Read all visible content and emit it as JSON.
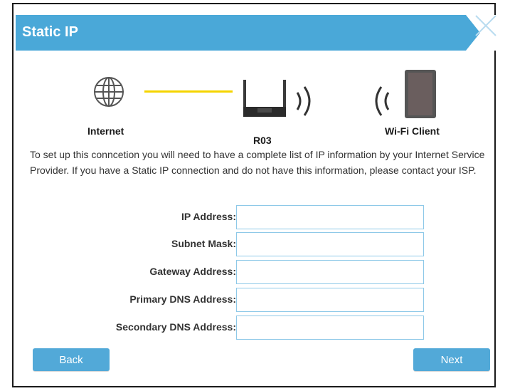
{
  "dialog": {
    "title": "Static IP"
  },
  "diagram": {
    "internet_label": "Internet",
    "router_label": "R03",
    "client_label": "Wi-Fi Client"
  },
  "description": "To set up this conncetion you will need to have a complete list of IP information by your Internet Service Provider. If you have a Static IP connection and do not have this information, please contact your ISP.",
  "form": {
    "fields": [
      {
        "label": "IP Address:",
        "value": ""
      },
      {
        "label": "Subnet Mask:",
        "value": ""
      },
      {
        "label": "Gateway Address:",
        "value": ""
      },
      {
        "label": "Primary DNS Address:",
        "value": ""
      },
      {
        "label": "Secondary DNS Address:",
        "value": ""
      }
    ]
  },
  "buttons": {
    "back": "Back",
    "next": "Next"
  },
  "colors": {
    "header": "#4aa8d8",
    "button": "#52a9d8",
    "connection_line": "#f5d400",
    "input_border": "#8ec9e8"
  },
  "icons": {
    "internet": "globe-icon",
    "router": "router-icon",
    "wifi_signal": "wifi-waves-icon",
    "client": "tablet-icon",
    "close": "close-icon"
  }
}
